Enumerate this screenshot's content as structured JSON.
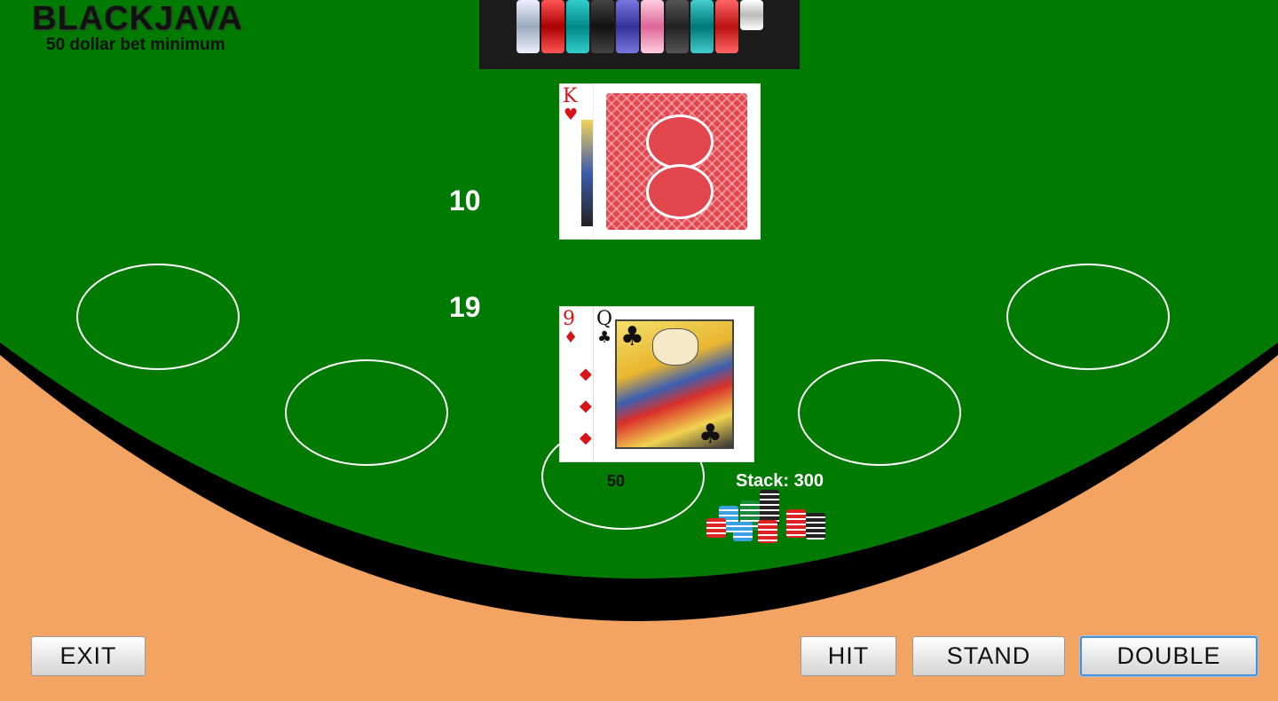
{
  "header": {
    "title": "BLACKJAVA",
    "subtitle": "50 dollar bet minimum"
  },
  "dealer": {
    "score": "10",
    "visible_card": {
      "rank": "K",
      "suit": "♥"
    }
  },
  "player": {
    "score": "19",
    "cards": [
      {
        "rank": "9",
        "suit": "♦"
      },
      {
        "rank": "Q",
        "suit": "♣"
      }
    ],
    "bet": "50",
    "stack_label": "Stack: 300"
  },
  "buttons": {
    "exit": "EXIT",
    "hit": "HIT",
    "stand": "STAND",
    "double": "DOUBLE"
  },
  "colors": {
    "felt": "#007a00",
    "rail": "#000000",
    "background": "#f4a462"
  }
}
